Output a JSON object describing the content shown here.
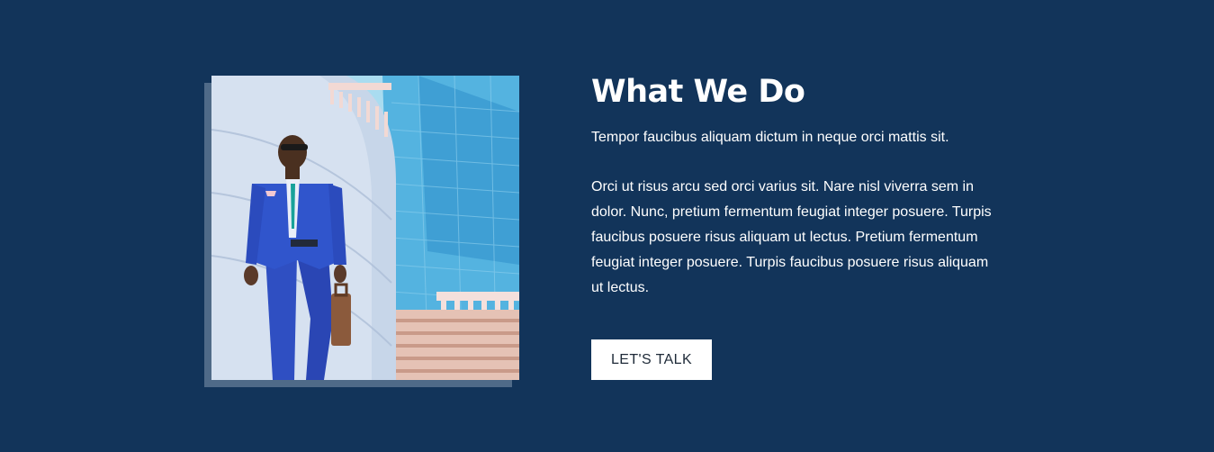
{
  "section": {
    "title": "What We Do",
    "lead": "Tempor faucibus aliquam dictum in neque orci mattis sit.",
    "body": "Orci ut risus arcu sed orci varius sit. Nare nisl viverra sem in dolor. Nunc, pretium fermentum feugiat integer posuere. Turpis faucibus posuere risus aliquam ut lectus. Pretium fermentum feugiat integer posuere. Turpis faucibus posuere risus aliquam ut lectus.",
    "cta_label": "LET'S TALK"
  },
  "colors": {
    "background": "#12345a",
    "shadow_block": "#4f6a88",
    "button_bg": "#ffffff",
    "button_text": "#1e2a38"
  }
}
